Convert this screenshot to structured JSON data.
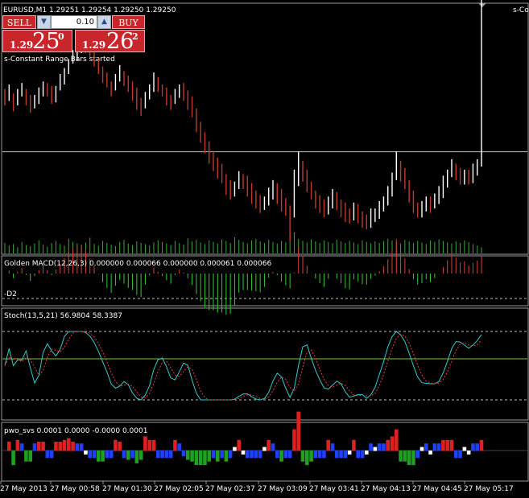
{
  "header": {
    "title": "EURUSD,M1  1.29251 1.29254 1.29250 1.29250",
    "right_label": "s-Con"
  },
  "trade_panel": {
    "sell_label": "SELL",
    "buy_label": "BUY",
    "lot_value": "0.10",
    "down_arrow": "▼",
    "up_arrow": "▲",
    "sell_price_small": "1.29",
    "sell_price_big": "25",
    "sell_price_sup": "0",
    "buy_price_small": "1.29",
    "buy_price_big": "26",
    "buy_price_sup": "2"
  },
  "status_text": "s-Constant Range Bars started",
  "indicators": {
    "macd_label": "Golden MACD(12,26,3) 0.000000 0.000066 0.000000 0.000061 0.000066",
    "macd_sub_label": "-D2",
    "stoch_label": "Stoch(13,5,21) 56.9804 58.3387",
    "pwo_label": "pwo_svs 0.0001 0.0000 -0.0000 0.0001"
  },
  "time_axis": {
    "labels": [
      "27 May 2013",
      "27 May 00:58",
      "27 May 01:30",
      "27 May 02:05",
      "27 May 02:37",
      "27 May 03:09",
      "27 May 03:41",
      "27 May 04:13",
      "27 May 04:45",
      "27 May 05:17"
    ]
  },
  "colors": {
    "background": "#000000",
    "bull_candle": "#ffffff",
    "bear_candle": "#c0392b",
    "volume": "#3aa83a",
    "macd_green": "#33cc33",
    "macd_red": "#d94040",
    "stoch_main": "#33cccc",
    "stoch_signal": "#e04040",
    "stoch_mid_line": "#7dc23a",
    "pwo_white": "#ffffff",
    "pwo_red": "#e02020",
    "pwo_blue": "#2040ff",
    "pwo_green": "#20a020",
    "trade_red": "#c8262b"
  },
  "chart_data": {
    "type": "candlestick",
    "close": [
      1.29285,
      1.2929,
      1.29282,
      1.29288,
      1.29292,
      1.29286,
      1.2928,
      1.29284,
      1.29289,
      1.29294,
      1.2929,
      1.29286,
      1.29291,
      1.29296,
      1.29302,
      1.29309,
      1.29314,
      1.29318,
      1.29322,
      1.2932,
      1.29316,
      1.29312,
      1.29306,
      1.293,
      1.29296,
      1.29292,
      1.29298,
      1.29303,
      1.29299,
      1.29294,
      1.2929,
      1.29283,
      1.29278,
      1.29286,
      1.29292,
      1.29298,
      1.29294,
      1.2929,
      1.29286,
      1.29282,
      1.29288,
      1.29292,
      1.29289,
      1.29284,
      1.29278,
      1.2927,
      1.29262,
      1.29254,
      1.29248,
      1.29244,
      1.29238,
      1.29234,
      1.29228,
      1.29224,
      1.29226,
      1.29232,
      1.2923,
      1.29226,
      1.29222,
      1.29218,
      1.29214,
      1.29216,
      1.29222,
      1.29226,
      1.29222,
      1.29216,
      1.29212,
      1.29208,
      1.2922,
      1.29242,
      1.29236,
      1.29228,
      1.29222,
      1.29218,
      1.29214,
      1.2921,
      1.29216,
      1.2922,
      1.29216,
      1.29212,
      1.29208,
      1.29206,
      1.29212,
      1.29208,
      1.29204,
      1.29202,
      1.29206,
      1.29208,
      1.29212,
      1.29216,
      1.29222,
      1.2923,
      1.29242,
      1.29236,
      1.2923,
      1.29222,
      1.29214,
      1.2921,
      1.29212,
      1.29216,
      1.29214,
      1.29218,
      1.29222,
      1.29228,
      1.29234,
      1.2924,
      1.29236,
      1.29232,
      1.29234,
      1.29232,
      1.29236,
      1.2924,
      1.29246
    ],
    "open_offset": [
      -3,
      3,
      -4,
      3,
      2,
      -3,
      -3,
      2,
      3,
      2,
      -2,
      -3,
      3,
      2,
      3,
      3,
      2,
      2,
      2,
      -1,
      -2,
      -2,
      -3,
      -3,
      -2,
      -2,
      3,
      3,
      -2,
      -3,
      -2,
      -4,
      -3,
      4,
      3,
      3,
      -2,
      -2,
      -2,
      -2,
      3,
      2,
      -2,
      -3,
      -3,
      -4,
      -4,
      -4,
      -3,
      -2,
      -3,
      -2,
      -3,
      -2,
      1,
      3,
      -1,
      -2,
      -2,
      -2,
      -2,
      1,
      3,
      2,
      -2,
      -3,
      -2,
      -2,
      6,
      10,
      -3,
      -4,
      -3,
      -2,
      -2,
      -2,
      3,
      2,
      -2,
      -2,
      -2,
      -1,
      3,
      -2,
      -2,
      -1,
      2,
      1,
      2,
      2,
      3,
      4,
      6,
      -3,
      -3,
      -4,
      -4,
      -2,
      1,
      2,
      -1,
      2,
      2,
      3,
      3,
      3,
      -2,
      -2,
      1,
      -1,
      2,
      2,
      3
    ],
    "high_ext": [
      4,
      5,
      3,
      4,
      4,
      3,
      5,
      4,
      4,
      3,
      4,
      5,
      3,
      6,
      4,
      3,
      4,
      5,
      6,
      3,
      4,
      5,
      3,
      4,
      5,
      3,
      4,
      5,
      3,
      4,
      5,
      6,
      5,
      4,
      3,
      5,
      4,
      3,
      5,
      4,
      4,
      3,
      5,
      4,
      6,
      5,
      4,
      5,
      6,
      4,
      5,
      6,
      4,
      5,
      4,
      5,
      4,
      6,
      5,
      4,
      5,
      4,
      4,
      5,
      5,
      6,
      5,
      4,
      18,
      8,
      5,
      6,
      5,
      4,
      5,
      6,
      4,
      5,
      5,
      4,
      6,
      5,
      4,
      5,
      4,
      5,
      6,
      4,
      5,
      4,
      5,
      6,
      8,
      5,
      6,
      5,
      6,
      4,
      5,
      4,
      5,
      4,
      5,
      6,
      4,
      5,
      4,
      5,
      4,
      5,
      6,
      5
    ],
    "low_ext": [
      4,
      3,
      5,
      4,
      3,
      5,
      4,
      3,
      4,
      5,
      3,
      4,
      5,
      3,
      4,
      4,
      3,
      5,
      4,
      4,
      3,
      5,
      4,
      4,
      3,
      5,
      4,
      3,
      5,
      4,
      6,
      5,
      4,
      3,
      4,
      5,
      4,
      3,
      5,
      4,
      3,
      4,
      5,
      6,
      5,
      7,
      6,
      5,
      6,
      7,
      6,
      5,
      7,
      6,
      5,
      4,
      5,
      6,
      7,
      6,
      5,
      4,
      5,
      6,
      7,
      6,
      5,
      18,
      8,
      5,
      6,
      5,
      4,
      6,
      5,
      4,
      5,
      6,
      5,
      6,
      5,
      4,
      5,
      6,
      5,
      4,
      5,
      4,
      5,
      4,
      5,
      6,
      5,
      6,
      5,
      6,
      5,
      4,
      5,
      4,
      5,
      4,
      5,
      6,
      5,
      4,
      5,
      4,
      5,
      4,
      5,
      4,
      3
    ],
    "volume": [
      20,
      15,
      18,
      12,
      22,
      16,
      14,
      19,
      25,
      17,
      13,
      20,
      24,
      18,
      15,
      28,
      22,
      19,
      16,
      21,
      30,
      18,
      15,
      24,
      20,
      17,
      14,
      22,
      26,
      19,
      16,
      23,
      20,
      18,
      15,
      21,
      25,
      22,
      19,
      16,
      24,
      20,
      17,
      29,
      23,
      26,
      21,
      18,
      25,
      22,
      19,
      27,
      24,
      20,
      31,
      26,
      22,
      19,
      25,
      28,
      23,
      20,
      26,
      22,
      19,
      24,
      21,
      35,
      40,
      28,
      24,
      21,
      27,
      23,
      20,
      25,
      22,
      19,
      26,
      23,
      20,
      24,
      21,
      18,
      25,
      22,
      19,
      23,
      20,
      24,
      28,
      25,
      22,
      19,
      26,
      23,
      20,
      24,
      21,
      18,
      25,
      22,
      27,
      24,
      21,
      19,
      23,
      20,
      25,
      22,
      18,
      15,
      12
    ],
    "price_line": 1.2925,
    "ylim": [
      1.2919,
      1.2933
    ],
    "x_labels": [
      "27 May 2013",
      "27 May 00:58",
      "27 May 01:30",
      "27 May 02:05",
      "27 May 02:37",
      "27 May 03:09",
      "27 May 03:41",
      "27 May 04:13",
      "27 May 04:45",
      "27 May 05:17"
    ]
  }
}
